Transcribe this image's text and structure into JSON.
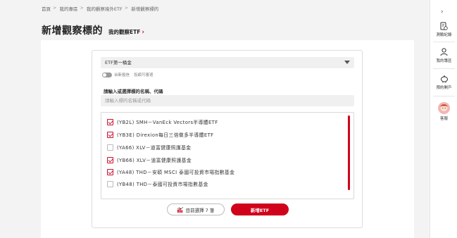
{
  "breadcrumb": [
    "首頁",
    "我的專區",
    "我的觀察境外ETF",
    "新增觀察標的"
  ],
  "header": {
    "title": "新增觀察標的",
    "watch_link": "我的觀察ETF"
  },
  "form": {
    "category_select": "ETF第一桶金",
    "toggle_label_1": "台新投信",
    "toggle_label_2": "投顧可審選",
    "input_label": "請輸入或選擇標的名稱、代碼",
    "input_placeholder": "請輸入標的名稱或代碼",
    "input_value": ""
  },
  "list": {
    "items": [
      {
        "label": "(YB2L) SMH－VanEck Vectors半導體ETF",
        "checked": true
      },
      {
        "label": "(YB3E) Direxion每日三倍做多半導體ETF",
        "checked": true
      },
      {
        "label": "(YA66) XLV－道富健康照護基金",
        "checked": false
      },
      {
        "label": "(YB66) XLV－道富健康照護基金",
        "checked": true
      },
      {
        "label": "(YA48) THD－安碩 MSCI 泰國可投資市場指數基金",
        "checked": true
      },
      {
        "label": "(YB48) THD－泰國可投資市場指數基金",
        "checked": false
      }
    ]
  },
  "buttons": {
    "selected_label": "目前選擇 7 筆",
    "add_label": "新增ETF"
  },
  "sidebar": {
    "items": [
      "測驗紀錄",
      "我的專區",
      "預約開戶",
      "客服"
    ]
  },
  "colors": {
    "accent": "#d0021b"
  }
}
